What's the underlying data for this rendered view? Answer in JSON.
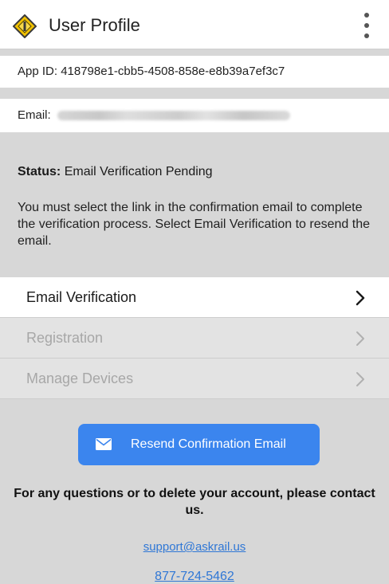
{
  "header": {
    "title": "User Profile",
    "logo_icon": "yellow-diamond-logo",
    "menu_icon": "kebab-menu-icon",
    "logo_color": "#f2c200"
  },
  "app_id": {
    "text": "App ID: 418798e1-cbb5-4508-858e-e8b39a7ef3c7"
  },
  "email": {
    "label": "Email:"
  },
  "status": {
    "label": "Status:",
    "value": "Email Verification Pending",
    "message": "You must select the link in the confirmation email to complete the verification process. Select Email Verification to resend the email."
  },
  "menu": {
    "items": [
      {
        "label": "Email Verification",
        "state": "enabled"
      },
      {
        "label": "Registration",
        "state": "disabled"
      },
      {
        "label": "Manage Devices",
        "state": "disabled"
      }
    ]
  },
  "resend_button": {
    "label": "Resend Confirmation Email",
    "icon": "mail-icon",
    "color": "#3b85ee"
  },
  "contact": {
    "text": "For any questions or to delete your account, please contact us.",
    "email": "support@askrail.us",
    "phone": "877-724-5462",
    "link_color": "#2f77d6"
  }
}
